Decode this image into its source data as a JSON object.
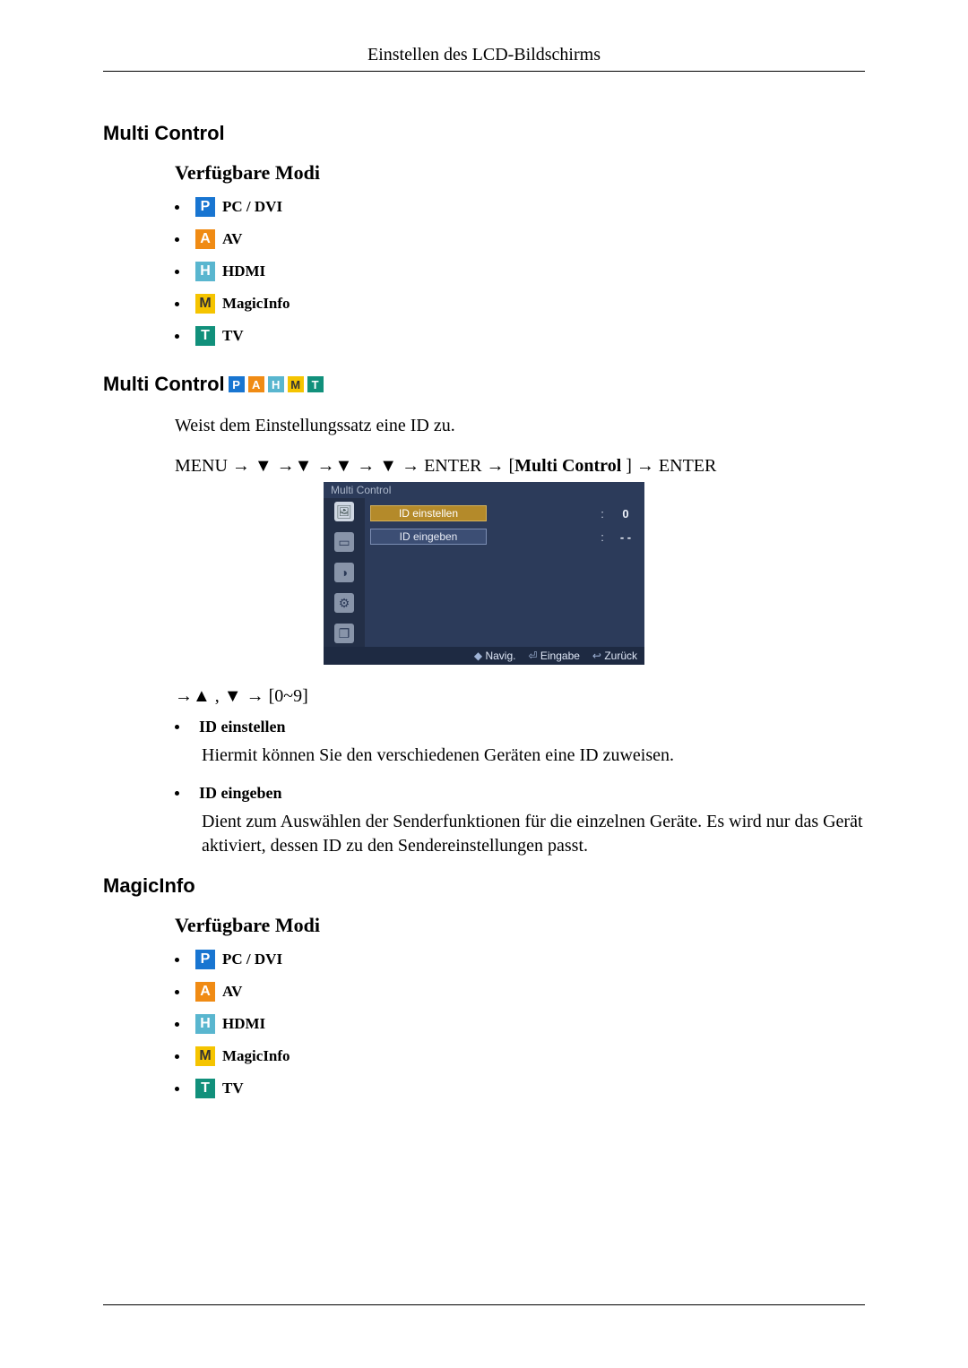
{
  "header": {
    "running_head": "Einstellen des LCD-Bildschirms"
  },
  "icons": {
    "P": "P",
    "A": "A",
    "H": "H",
    "M": "M",
    "T": "T"
  },
  "modes_labels": {
    "pc_dvi": "PC / DVI",
    "av": "AV",
    "hdmi": "HDMI",
    "magicinfo": "MagicInfo",
    "tv": "TV"
  },
  "section1": {
    "title": "Multi Control",
    "modes_heading": "Verfügbare Modi"
  },
  "section2": {
    "title": "Multi Control",
    "intro": "Weist dem Einstellungssatz eine ID zu.",
    "nav_prefix": "MENU → ▼ →▼ →▼ → ▼ → ENTER → [",
    "nav_bold": "Multi Control ",
    "nav_suffix": "] → ENTER",
    "osd": {
      "title": "Multi Control",
      "row1": {
        "label": "ID einstellen",
        "value": "0"
      },
      "row2": {
        "label": "ID eingeben",
        "value": "- -"
      },
      "foot_nav": "Navig.",
      "foot_enter": "Eingabe",
      "foot_back": "Zurück"
    },
    "dir_line": "→▲ , ▼ → [0~9]",
    "items": [
      {
        "label": "ID einstellen",
        "text": "Hiermit können Sie den verschiedenen Geräten eine ID zuweisen."
      },
      {
        "label": "ID eingeben",
        "text": "Dient zum Auswählen der Senderfunktionen für die einzelnen Geräte. Es wird nur das Gerät aktiviert, dessen ID zu den Sendereinstellungen passt."
      }
    ]
  },
  "section3": {
    "title": "MagicInfo",
    "modes_heading": "Verfügbare Modi"
  }
}
